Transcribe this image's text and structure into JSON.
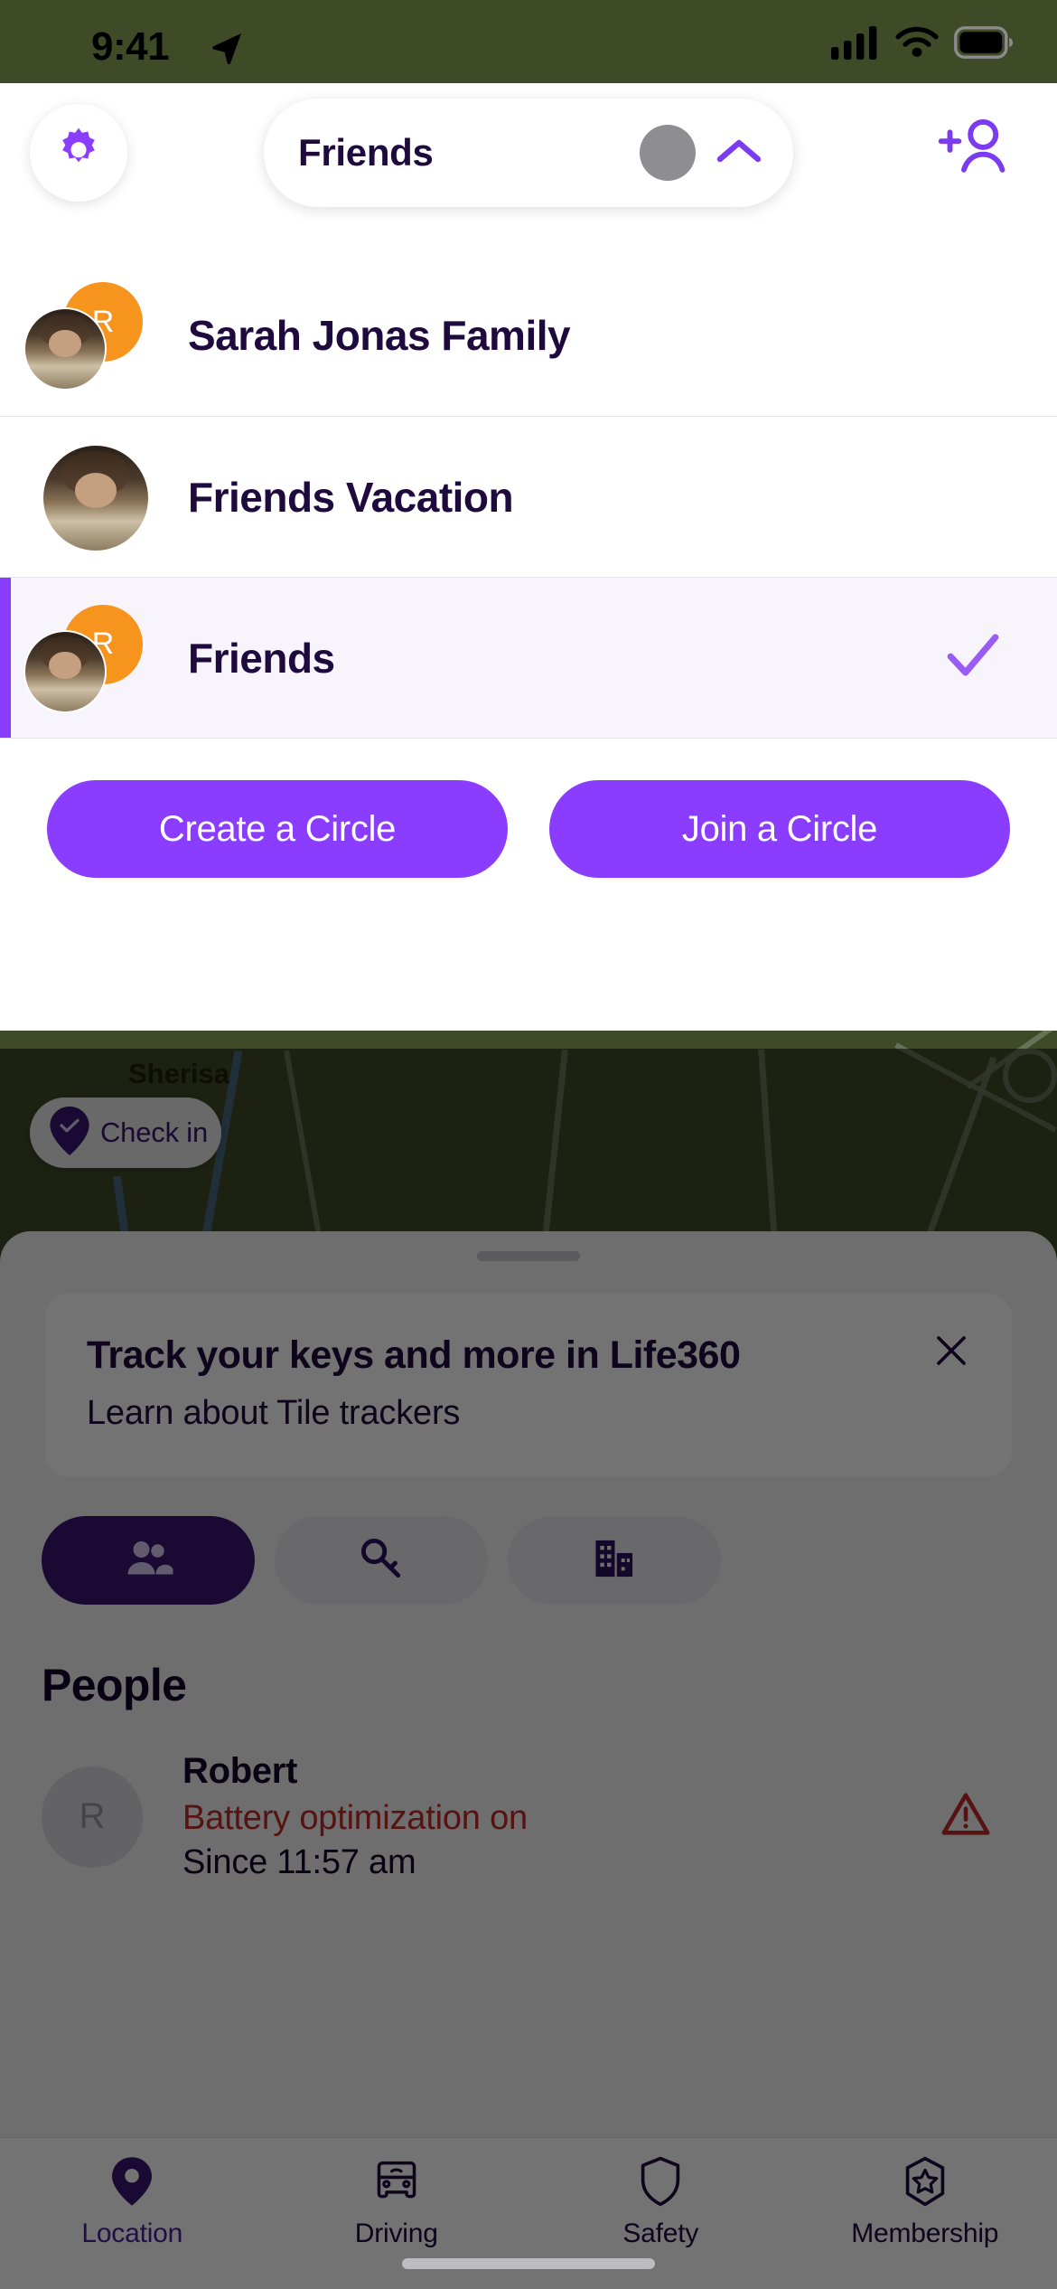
{
  "status_bar": {
    "time": "9:41",
    "location_icon": "location-arrow-icon",
    "signal_icon": "cellular-signal-icon",
    "wifi_icon": "wifi-icon",
    "battery_icon": "battery-full-icon"
  },
  "header": {
    "settings_icon": "gear-icon",
    "circle_name": "Friends",
    "avatar": "circle-avatar",
    "chevron_icon": "chevron-up-icon",
    "add_member_icon": "add-person-icon"
  },
  "circle_switcher": {
    "circles": [
      {
        "name": "Sarah Jonas Family",
        "initial": "R",
        "selected": false,
        "avatars": 2
      },
      {
        "name": "Friends Vacation",
        "initial": "",
        "selected": false,
        "avatars": 1
      },
      {
        "name": "Friends",
        "initial": "R",
        "selected": true,
        "avatars": 2
      }
    ],
    "create_label": "Create a Circle",
    "join_label": "Join a Circle",
    "check_icon": "checkmark-icon"
  },
  "map": {
    "place_label": "Sherisa",
    "checkin_label": "Check in",
    "checkin_icon": "map-pin-check-icon"
  },
  "sheet": {
    "handle": "drag-handle",
    "promo": {
      "title": "Track your keys and more in Life360",
      "subtitle": "Learn about Tile trackers",
      "close_icon": "close-icon"
    },
    "tabs": [
      {
        "icon": "people-icon",
        "active": true
      },
      {
        "icon": "tile-key-icon",
        "active": false
      },
      {
        "icon": "places-building-icon",
        "active": false
      }
    ],
    "people_heading": "People",
    "people": [
      {
        "name": "Robert",
        "initial": "R",
        "status": "Battery optimization on",
        "since": "Since 11:57 am",
        "warning_icon": "warning-triangle-icon"
      }
    ]
  },
  "bottom_nav": [
    {
      "label": "Location",
      "icon": "map-pin-icon",
      "active": true
    },
    {
      "label": "Driving",
      "icon": "car-icon",
      "active": false
    },
    {
      "label": "Safety",
      "icon": "shield-icon",
      "active": false
    },
    {
      "label": "Membership",
      "icon": "badge-star-icon",
      "active": false
    }
  ],
  "colors": {
    "brand_purple": "#8b3dff",
    "deep_purple": "#3b1570",
    "text_dark": "#1f0a3e",
    "warning_red": "#c02929",
    "avatar_orange": "#f7941d"
  }
}
